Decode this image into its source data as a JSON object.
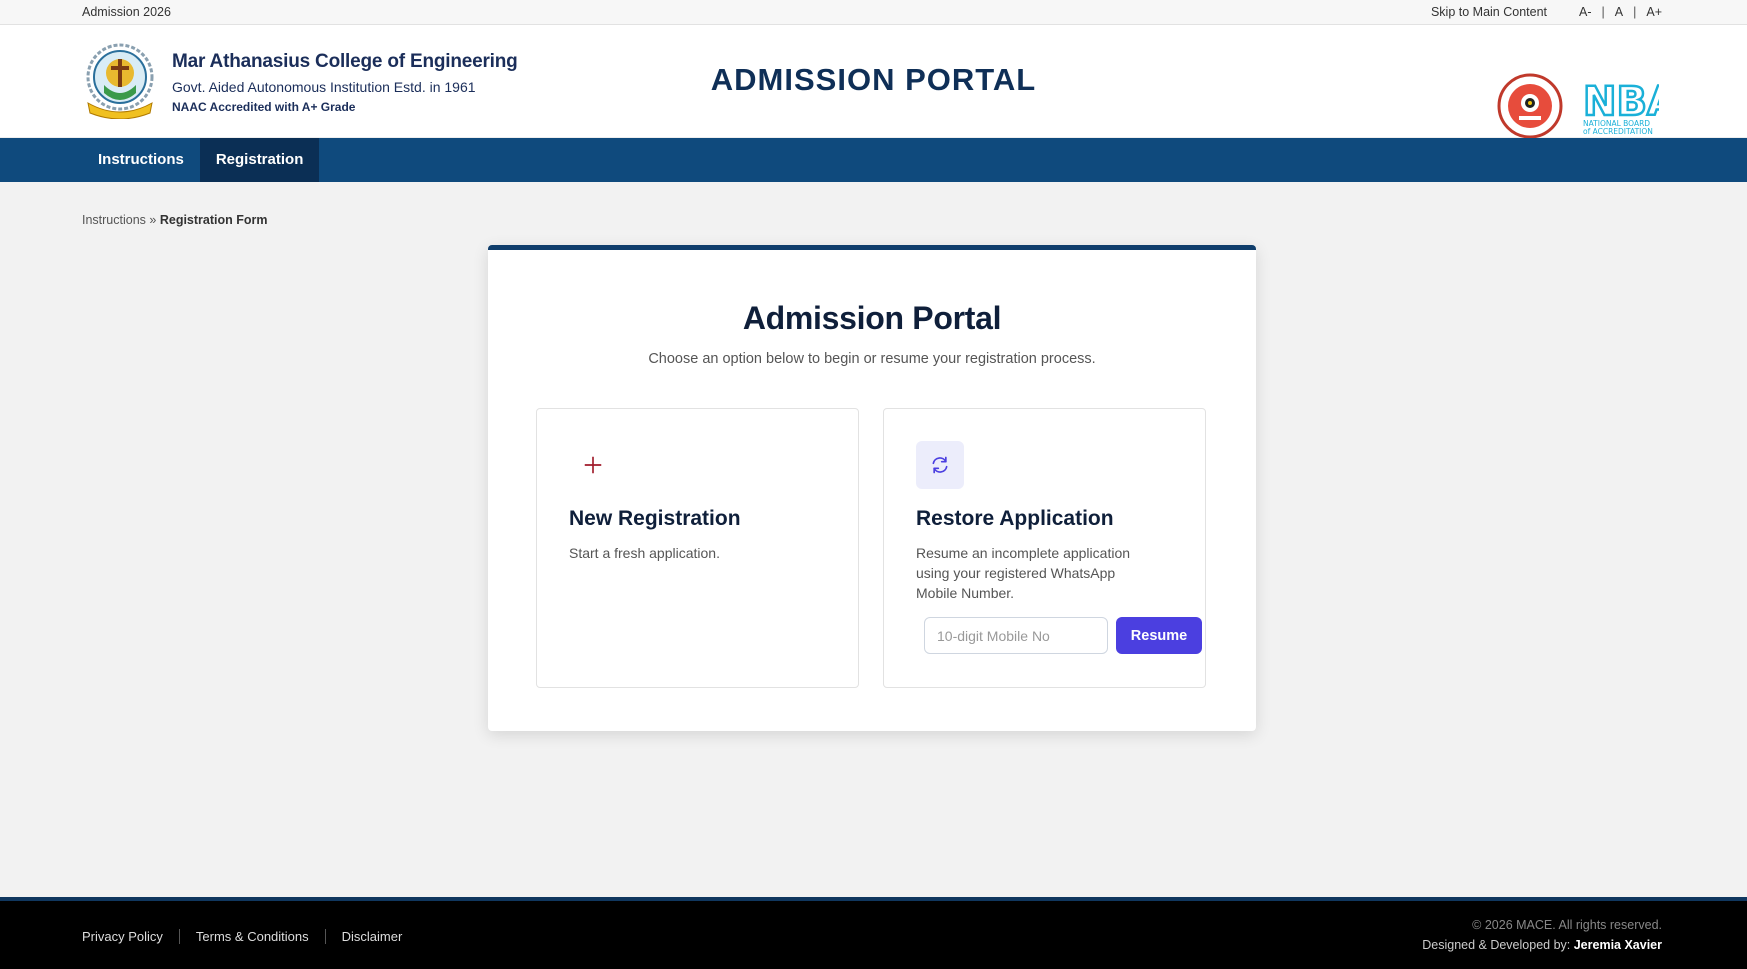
{
  "topbar": {
    "left": "Admission 2026",
    "skip": "Skip to Main Content",
    "font_small": "A-",
    "font_normal": "A",
    "font_large": "A+",
    "separator": "|"
  },
  "header": {
    "college_name": "Mar Athanasius College of Engineering",
    "college_sub": "Govt. Aided Autonomous Institution Estd. in 1961",
    "naac": "NAAC Accredited with A+ Grade",
    "portal_title": "ADMISSION PORTAL",
    "logo_icon": "college-emblem-icon",
    "naac_logo_icon": "naac-seal-icon",
    "nba_logo_icon": "nba-logo-icon",
    "nba_text": "NBA",
    "nba_line1": "NATIONAL BOARD",
    "nba_line2": "of ACCREDITATION"
  },
  "nav": {
    "items": [
      {
        "label": "Instructions"
      },
      {
        "label": "Registration"
      }
    ],
    "active": "Registration"
  },
  "breadcrumb": {
    "parent": "Instructions",
    "separator": "»",
    "current": "Registration Form"
  },
  "card": {
    "title": "Admission Portal",
    "subtitle": "Choose an option below to begin or resume your registration process.",
    "new_registration": {
      "icon": "plus-icon",
      "title": "New Registration",
      "description": "Start a fresh application."
    },
    "restore": {
      "icon": "refresh-icon",
      "title": "Restore Application",
      "description": "Resume an incomplete application using your registered WhatsApp Mobile Number.",
      "input_placeholder": "10-digit Mobile No",
      "input_value": "",
      "button_label": "Resume"
    }
  },
  "footer": {
    "links": [
      {
        "label": "Privacy Policy"
      },
      {
        "label": "Terms & Conditions"
      },
      {
        "label": "Disclaimer"
      }
    ],
    "copyright": "© 2026 MACE. All rights reserved.",
    "credit_prefix": "Designed & Developed by:",
    "credit_name": "Jeremia Xavier"
  },
  "colors": {
    "navbar": "#0f4a7d",
    "nav_active": "#0b2f55",
    "title": "#0f2f57",
    "resume_button": "#4b3fe0",
    "plus_icon": "#a01a2a",
    "footer": "#000000"
  }
}
